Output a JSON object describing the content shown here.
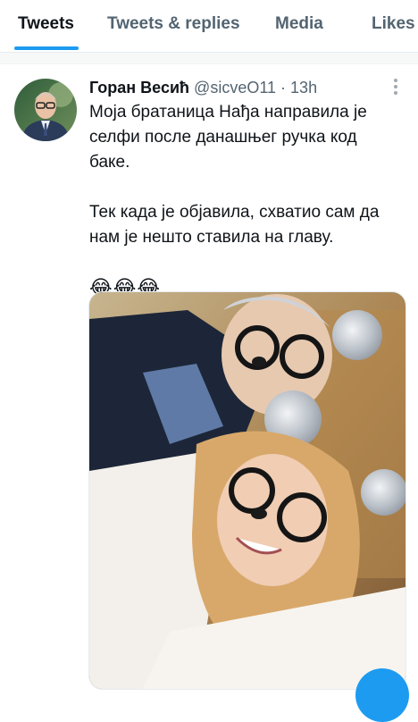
{
  "tabs": [
    {
      "label": "Tweets",
      "active": true
    },
    {
      "label": "Tweets & replies",
      "active": false
    },
    {
      "label": "Media",
      "active": false
    },
    {
      "label": "Likes",
      "active": false
    }
  ],
  "tweet": {
    "author_name": "Горан Весић",
    "author_handle": "@sicveO11",
    "separator": "·",
    "time": "13h",
    "text_line1": "Моја братаница Нађа направила је селфи после данашњег ручка код баке.",
    "text_line2": "Тек када је објавила, схватио сам да нам је нешто ставила на главу.",
    "emojis": "😂😂😂",
    "more_icon": "more-vertical-icon"
  },
  "colors": {
    "accent": "#1d9bf0",
    "text_primary": "#0f1419",
    "text_secondary": "#536471"
  }
}
